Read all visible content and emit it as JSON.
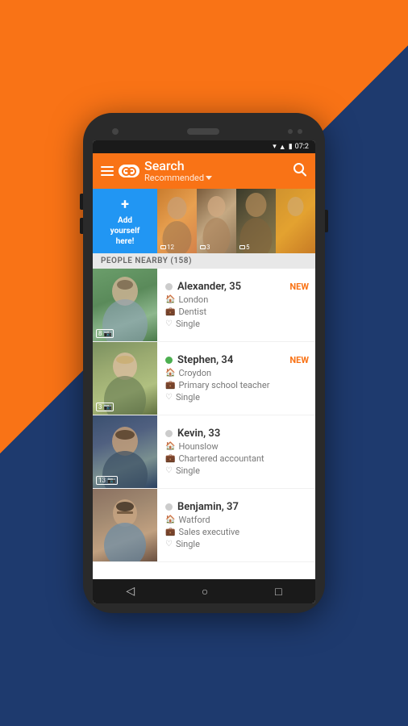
{
  "status_bar": {
    "time": "07:2",
    "icons": [
      "wifi",
      "signal",
      "battery"
    ]
  },
  "header": {
    "title": "Search",
    "subtitle": "Recommended",
    "menu_icon": "hamburger-icon",
    "logo_icon": "badoo-logo-icon",
    "search_icon": "search-icon"
  },
  "story_row": {
    "add_button": {
      "line1": "Add",
      "line2": "yourself",
      "line3": "here!"
    },
    "stories": [
      {
        "count": "12",
        "id": "story-1"
      },
      {
        "count": "3",
        "id": "story-2"
      },
      {
        "count": "5",
        "id": "story-3"
      },
      {
        "count": "",
        "id": "story-4"
      }
    ]
  },
  "section": {
    "label": "PEOPLE NEARBY (158)"
  },
  "people": [
    {
      "id": "alexander",
      "name": "Alexander",
      "age": "35",
      "location": "London",
      "occupation": "Dentist",
      "status": "Single",
      "online": false,
      "is_new": true,
      "photo_count": "8"
    },
    {
      "id": "stephen",
      "name": "Stephen",
      "age": "34",
      "location": "Croydon",
      "occupation": "Primary school teacher",
      "status": "Single",
      "online": true,
      "is_new": true,
      "photo_count": "3"
    },
    {
      "id": "kevin",
      "name": "Kevin",
      "age": "33",
      "location": "Hounslow",
      "occupation": "Chartered accountant",
      "status": "Single",
      "online": false,
      "is_new": false,
      "photo_count": "13"
    },
    {
      "id": "benjamin",
      "name": "Benjamin",
      "age": "37",
      "location": "Watford",
      "occupation": "Sales executive",
      "status": "Single",
      "online": false,
      "is_new": false,
      "photo_count": ""
    }
  ],
  "nav": {
    "back_icon": "◁",
    "home_icon": "○",
    "recent_icon": "□"
  },
  "new_label": "NEW"
}
